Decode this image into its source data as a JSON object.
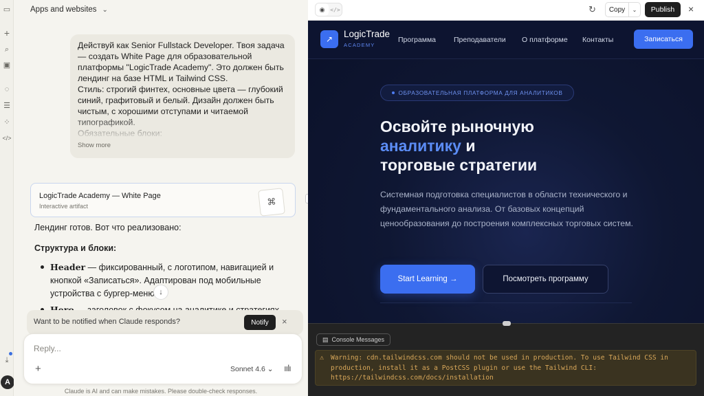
{
  "chat": {
    "header_title": "Apps and websites",
    "user_message": "Действуй как Senior Fullstack Developer. Твоя задача — создать White Page для образовательной платформы \"LogicTrade Academy\". Это должен быть лендинг на базе HTML и Tailwind CSS.\nСтиль: строгий финтех, основные цвета — глубокий синий, графитовый и белый. Дизайн должен быть чистым, с хорошими отступами и читаемой типографикой.\nОбязательные блоки:",
    "show_more": "Show more",
    "artifact": {
      "title": "LogicTrade Academy — White Page",
      "subtitle": "Interactive artifact"
    },
    "reply": {
      "intro": "Лендинг готов. Вот что реализовано:",
      "heading": "Структура и блоки:",
      "items": [
        {
          "term": "Header",
          "text": " — фиксированный, с логотипом, навигацией и кнопкой «Записаться». Адаптирован под мобильные устройства с бургер-меню."
        },
        {
          "term": "Hero",
          "text": " — заголовок с фокусом на аналитике и стратегиях,"
        }
      ]
    },
    "notify": {
      "text": "Want to be notified when Claude responds?",
      "button": "Notify"
    },
    "composer": {
      "placeholder": "Reply...",
      "model": "Sonnet 4.6 ⌄"
    },
    "disclaimer": "Claude is AI and can make mistakes. Please double-check responses.",
    "avatar_initial": "A"
  },
  "preview_toolbar": {
    "copy": "Copy",
    "publish": "Publish"
  },
  "site": {
    "logo": {
      "name": "LogicTrade",
      "sub": "ACADEMY"
    },
    "nav": [
      "Программа",
      "Преподаватели",
      "О платформе",
      "Контакты"
    ],
    "nav_cta": "Записаться",
    "badge": "ОБРАЗОВАТЕЛЬНАЯ ПЛАТФОРМА ДЛЯ АНАЛИТИКОВ",
    "title_line1": "Освойте рыночную",
    "title_accent": "аналитику",
    "title_line2_rest": " и",
    "title_line3": "торговые стратегии",
    "description": "Системная подготовка специалистов в области технического и фундаментального анализа. От базовых концепций ценообразования до построения комплексных торговых систем.",
    "btn_primary": "Start Learning →",
    "btn_secondary": "Посмотреть программу"
  },
  "console": {
    "tab": "Console Messages",
    "warning": "Warning: cdn.tailwindcss.com should not be used in production. To use Tailwind CSS in production, install it as a PostCSS plugin or use the Tailwind CLI: https://tailwindcss.com/docs/installation"
  },
  "colors": {
    "accent": "#3b6ef0",
    "site_bg": "#0f1733",
    "warning_text": "#d9a85a"
  }
}
